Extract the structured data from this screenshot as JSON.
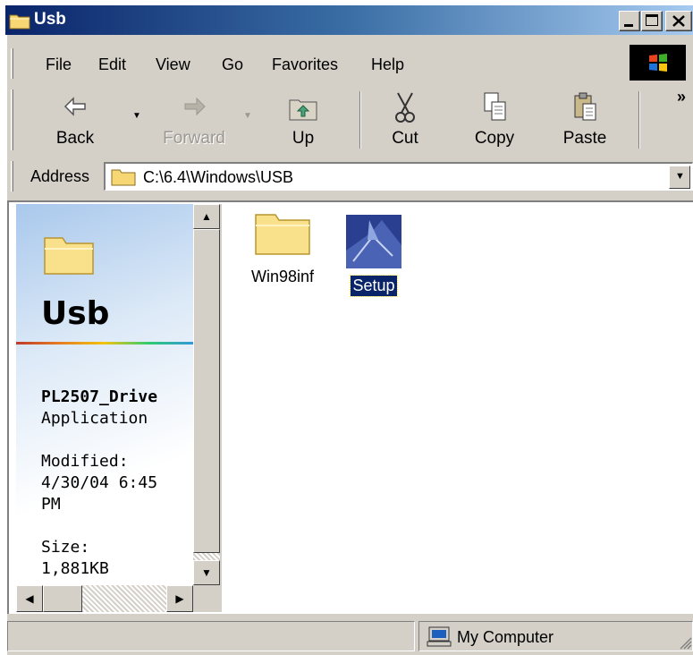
{
  "window": {
    "title": "Usb"
  },
  "menu": {
    "items": [
      "File",
      "Edit",
      "View",
      "Go",
      "Favorites",
      "Help"
    ]
  },
  "toolbar": {
    "back": "Back",
    "forward": "Forward",
    "up": "Up",
    "cut": "Cut",
    "copy": "Copy",
    "paste": "Paste",
    "overflow": "»"
  },
  "address": {
    "label": "Address",
    "path": "C:\\6.4\\Windows\\USB"
  },
  "left_pane": {
    "folder_title": "Usb",
    "selected_name": "PL2507_Drive",
    "selected_type": "Application",
    "modified_label": "Modified:",
    "modified_date": "4/30/04 6:45",
    "modified_ampm": "PM",
    "size_label": "Size:",
    "size_value": "1,881KB"
  },
  "files": [
    {
      "name": "Win98inf",
      "icon": "folder-icon",
      "selected": false
    },
    {
      "name": "Setup",
      "icon": "setup-app-icon",
      "selected": true
    }
  ],
  "status": {
    "zone": "My Computer"
  },
  "colors": {
    "title_dark": "#0a246a",
    "title_light": "#a6caf0",
    "chrome": "#d4d0c8",
    "selection": "#0a246a"
  }
}
